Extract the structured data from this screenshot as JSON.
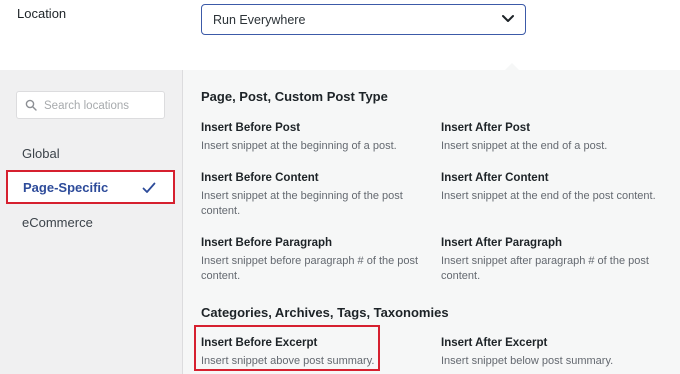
{
  "location": {
    "label": "Location",
    "selected": "Run Everywhere"
  },
  "sidebar": {
    "search_placeholder": "Search locations",
    "items": [
      {
        "label": "Global"
      },
      {
        "label": "Page-Specific",
        "active": true
      },
      {
        "label": "eCommerce"
      }
    ]
  },
  "sections": [
    {
      "title": "Page, Post, Custom Post Type",
      "options": [
        {
          "title": "Insert Before Post",
          "desc": "Insert snippet at the beginning of a post."
        },
        {
          "title": "Insert After Post",
          "desc": "Insert snippet at the end of a post."
        },
        {
          "title": "Insert Before Content",
          "desc": "Insert snippet at the beginning of the post content."
        },
        {
          "title": "Insert After Content",
          "desc": "Insert snippet at the end of the post content."
        },
        {
          "title": "Insert Before Paragraph",
          "desc": "Insert snippet before paragraph # of the post content."
        },
        {
          "title": "Insert After Paragraph",
          "desc": "Insert snippet after paragraph # of the post content."
        }
      ]
    },
    {
      "title": "Categories, Archives, Tags, Taxonomies",
      "options": [
        {
          "title": "Insert Before Excerpt",
          "desc": "Insert snippet above post summary."
        },
        {
          "title": "Insert After Excerpt",
          "desc": "Insert snippet below post summary."
        }
      ]
    }
  ],
  "colors": {
    "accent": "#2d4b9a",
    "highlight": "#d6202f",
    "panel_bg": "#f6f7f7"
  }
}
